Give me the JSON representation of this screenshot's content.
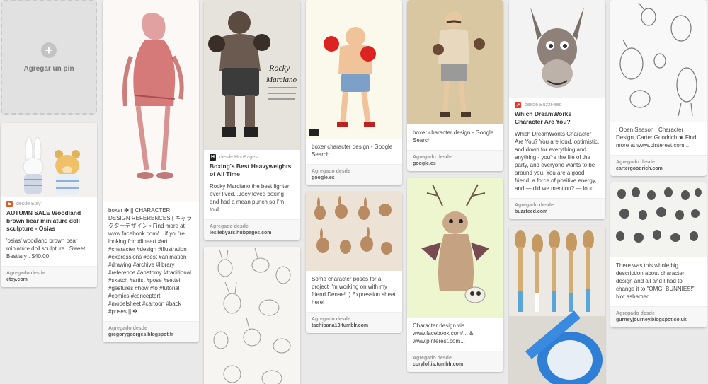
{
  "add_pin": {
    "label": "Agregar un pin"
  },
  "pins": {
    "bears": {
      "source": "desde Etsy",
      "title": "AUTUMN SALE Woodland brown bear miniature doll sculpture - Osias",
      "desc": "'osias' woodland brown bear miniature doll sculpture . Sweet Bestiary . $40.00",
      "added": "Agregado desde",
      "domain": "etsy.com"
    },
    "boxer_sketch": {
      "desc": "boxer ✤ || CHARACTER DESIGN REFERENCES | キャラクターデザイン • Find more at www.facebook.com/... if you're looking for: #lineart #art #character #design #illustration #expressions #best #animation #drawing #archive #library #reference #anatomy #traditional #sketch #artist #pose #settei #gestures #how #to #tutorial #comics #conceptart #modelsheet #cartoon #back #poses || ✤",
      "added": "Agregado desde",
      "domain": "gregorygeorges.blogspot.fr"
    },
    "rocky": {
      "source": "desde HubPages",
      "title": "Boxing's Best Heavyweights of All Time",
      "desc": "Rocky Marciano the best fighter ever lived...Joey loved boxing and had a mean punch so I'm told",
      "added": "Agregado desde",
      "domain": "lesliebyars.hubpages.com"
    },
    "boxer_color": {
      "desc": "boxer character design - Google Search",
      "added": "Agregado desde",
      "domain": "google.es"
    },
    "bunny_poses": {
      "desc": "Some character poses for a project I'm working on with my friend Denae! :) Expression sheet here!",
      "added": "Agregado desde",
      "domain": "tachibana13.tumblr.com"
    },
    "boxer_mustache": {
      "desc": "boxer character design - Google Search",
      "added": "Agregado desde",
      "domain": "google.es"
    },
    "jackalope": {
      "desc": "Character design via www.facebook.com/... & www.pinterest.com...",
      "added": "Agregado desde",
      "domain": "coryloftis.tumblr.com"
    },
    "donkey": {
      "source": "desde BuzzFeed",
      "title": "Which DreamWorks Character Are You?",
      "desc": "Which DreamWorks Character Are You? You are loud, optimistic, and down for everything and anything - you're the life of the party, and everyone wants to be around you. You are a good friend, a force of positive energy, and — did we mention? — loud.",
      "added": "Agregado desde",
      "domain": "buzzfeed.com"
    },
    "birds": {
      "desc": ": Open Season : Character Design, Carter Goodrich ★ Find more at www.pinterest.com...",
      "added": "Agregado desde",
      "domain": "cartergoodrich.com"
    },
    "bunnies": {
      "desc": "There was this whole big description about character design and all and I had to change it to \"OMG! BUNNIES!\" Not ashamed.",
      "added": "Agregado desde",
      "domain": "gurneyjourney.blogspot.co.uk"
    }
  },
  "colors": {
    "background": "#e9e9e9",
    "etsy": "#e45b26",
    "hubpages": "#222222",
    "buzzfeed": "#ee3322"
  }
}
